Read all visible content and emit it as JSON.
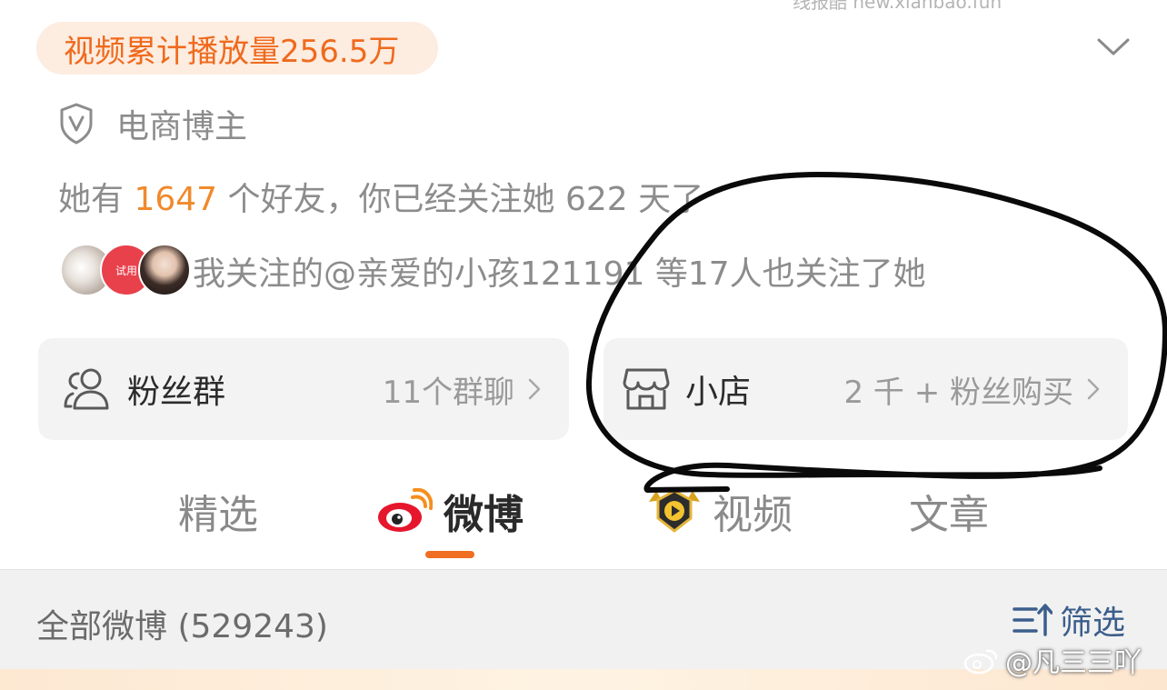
{
  "watermark_top": "线报酷 new.xianbao.fun",
  "stats_badge": "视频累计播放量256.5万",
  "verification": "电商博主",
  "friends": {
    "prefix": "她有 ",
    "count": "1647",
    "suffix": " 个好友，你已经关注她 622 天了"
  },
  "mutual": {
    "avatar_badge": "试用",
    "text": "我关注的@亲爱的小孩121191 等17人也关注了她"
  },
  "cards": {
    "fans_group": {
      "title": "粉丝群",
      "sub": "11个群聊"
    },
    "shop": {
      "title": "小店",
      "sub": "2 千 + 粉丝购买"
    }
  },
  "tabs": [
    "精选",
    "微博",
    "视频",
    "文章"
  ],
  "active_tab": "微博",
  "filter": {
    "all_label": "全部微博 (529243)",
    "filter_label": "筛选"
  },
  "watermark_handle": "@凡三三吖",
  "icons": [
    "shield-v-icon",
    "chevron-down-icon",
    "people-icon",
    "store-icon",
    "weibo-logo-icon",
    "video-badge-icon",
    "filter-sort-icon",
    "chevron-right-icon"
  ],
  "colors": {
    "accent_orange": "#ef6a1d",
    "badge_bg": "#fdece0",
    "link_blue": "#3b5e8c"
  }
}
